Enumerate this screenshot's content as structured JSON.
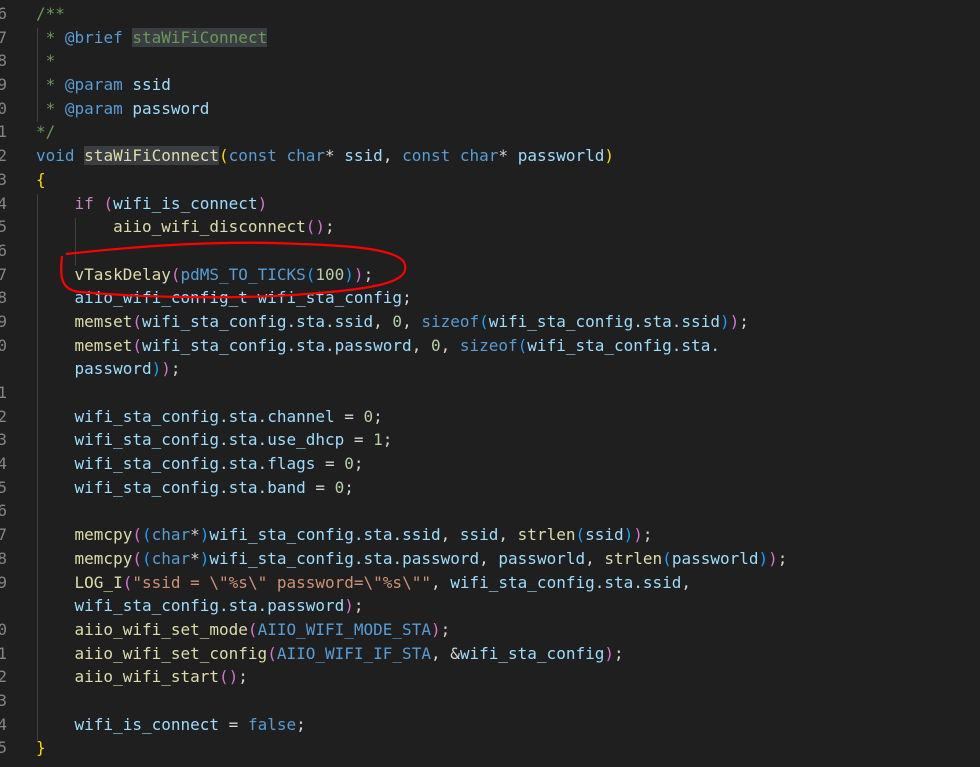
{
  "editor": {
    "colors": {
      "background": "#1f1f1f",
      "comment": "#6a9955",
      "keyword": "#569cd6",
      "variable": "#9cdcfe",
      "function": "#dcdcaa",
      "annotation": "#ff0000"
    },
    "lines": [
      {
        "n": "6",
        "t": [
          [
            "/**",
            "cm"
          ]
        ]
      },
      {
        "n": "7",
        "t": [
          [
            " * ",
            "cm"
          ],
          [
            "@brief",
            "tag"
          ],
          [
            " ",
            "cm"
          ],
          [
            "staWiFiConnect",
            "cm hl"
          ]
        ]
      },
      {
        "n": "8",
        "t": [
          [
            " *",
            "cm"
          ]
        ]
      },
      {
        "n": "9",
        "t": [
          [
            " * ",
            "cm"
          ],
          [
            "@param",
            "tag"
          ],
          [
            " ",
            "cm"
          ],
          [
            "ssid",
            "var"
          ]
        ]
      },
      {
        "n": "0",
        "t": [
          [
            " * ",
            "cm"
          ],
          [
            "@param",
            "tag"
          ],
          [
            " ",
            "cm"
          ],
          [
            "password",
            "var"
          ]
        ]
      },
      {
        "n": "1",
        "t": [
          [
            "*/",
            "cm"
          ]
        ]
      },
      {
        "n": "2",
        "t": [
          [
            "void",
            "kw"
          ],
          [
            " ",
            "op"
          ],
          [
            "staWiFiConnect",
            "fn hl"
          ],
          [
            "(",
            "b1"
          ],
          [
            "const",
            "kw"
          ],
          [
            " ",
            "op"
          ],
          [
            "char",
            "kw"
          ],
          [
            "* ",
            "op"
          ],
          [
            "ssid",
            "var"
          ],
          [
            ", ",
            "op"
          ],
          [
            "const",
            "kw"
          ],
          [
            " ",
            "op"
          ],
          [
            "char",
            "kw"
          ],
          [
            "* ",
            "op"
          ],
          [
            "passworld",
            "var"
          ],
          [
            ")",
            "b1"
          ]
        ]
      },
      {
        "n": "3",
        "t": [
          [
            "{",
            "b1"
          ]
        ]
      },
      {
        "n": "4",
        "t": [
          [
            "    ",
            "op"
          ],
          [
            "if",
            "ctl"
          ],
          [
            " ",
            "op"
          ],
          [
            "(",
            "b2"
          ],
          [
            "wifi_is_connect",
            "var"
          ],
          [
            ")",
            "b2"
          ]
        ]
      },
      {
        "n": "5",
        "t": [
          [
            "        ",
            "op"
          ],
          [
            "aiio_wifi_disconnect",
            "fn"
          ],
          [
            "()",
            "b2"
          ],
          [
            ";",
            "op"
          ]
        ]
      },
      {
        "n": "6",
        "t": []
      },
      {
        "n": "7",
        "t": [
          [
            "    ",
            "op"
          ],
          [
            "vTaskDelay",
            "fn"
          ],
          [
            "(",
            "b2"
          ],
          [
            "pdMS_TO_TICKS",
            "mac"
          ],
          [
            "(",
            "b3"
          ],
          [
            "100",
            "num"
          ],
          [
            ")",
            "b3"
          ],
          [
            ")",
            "b2"
          ],
          [
            ";",
            "op"
          ]
        ]
      },
      {
        "n": "8",
        "t": [
          [
            "    ",
            "op"
          ],
          [
            "aiio_wifi_config_t",
            "var"
          ],
          [
            " ",
            "op"
          ],
          [
            "wifi_sta_config",
            "var"
          ],
          [
            ";",
            "op"
          ]
        ]
      },
      {
        "n": "9",
        "t": [
          [
            "    ",
            "op"
          ],
          [
            "memset",
            "fn"
          ],
          [
            "(",
            "b2"
          ],
          [
            "wifi_sta_config.sta.ssid",
            "var"
          ],
          [
            ", ",
            "op"
          ],
          [
            "0",
            "num"
          ],
          [
            ", ",
            "op"
          ],
          [
            "sizeof",
            "kw"
          ],
          [
            "(",
            "b3"
          ],
          [
            "wifi_sta_config.sta.ssid",
            "var"
          ],
          [
            ")",
            "b3"
          ],
          [
            ")",
            "b2"
          ],
          [
            ";",
            "op"
          ]
        ]
      },
      {
        "n": "0",
        "t": [
          [
            "    ",
            "op"
          ],
          [
            "memset",
            "fn"
          ],
          [
            "(",
            "b2"
          ],
          [
            "wifi_sta_config.sta.password",
            "var"
          ],
          [
            ", ",
            "op"
          ],
          [
            "0",
            "num"
          ],
          [
            ", ",
            "op"
          ],
          [
            "sizeof",
            "kw"
          ],
          [
            "(",
            "b3"
          ],
          [
            "wifi_sta_config.sta.",
            "var"
          ]
        ]
      },
      {
        "n": "",
        "t": [
          [
            "    ",
            "op"
          ],
          [
            "password",
            "var"
          ],
          [
            ")",
            "b3"
          ],
          [
            ")",
            "b2"
          ],
          [
            ";",
            "op"
          ]
        ]
      },
      {
        "n": "1",
        "t": []
      },
      {
        "n": "2",
        "t": [
          [
            "    ",
            "op"
          ],
          [
            "wifi_sta_config.sta.channel",
            "var"
          ],
          [
            " = ",
            "op"
          ],
          [
            "0",
            "num"
          ],
          [
            ";",
            "op"
          ]
        ]
      },
      {
        "n": "3",
        "t": [
          [
            "    ",
            "op"
          ],
          [
            "wifi_sta_config.sta.use_dhcp",
            "var"
          ],
          [
            " = ",
            "op"
          ],
          [
            "1",
            "num"
          ],
          [
            ";",
            "op"
          ]
        ]
      },
      {
        "n": "4",
        "t": [
          [
            "    ",
            "op"
          ],
          [
            "wifi_sta_config.sta.flags",
            "var"
          ],
          [
            " = ",
            "op"
          ],
          [
            "0",
            "num"
          ],
          [
            ";",
            "op"
          ]
        ]
      },
      {
        "n": "5",
        "t": [
          [
            "    ",
            "op"
          ],
          [
            "wifi_sta_config.sta.band",
            "var"
          ],
          [
            " = ",
            "op"
          ],
          [
            "0",
            "num"
          ],
          [
            ";",
            "op"
          ]
        ]
      },
      {
        "n": "6",
        "t": []
      },
      {
        "n": "7",
        "t": [
          [
            "    ",
            "op"
          ],
          [
            "memcpy",
            "fn"
          ],
          [
            "(",
            "b2"
          ],
          [
            "(",
            "b3"
          ],
          [
            "char",
            "kw"
          ],
          [
            "*",
            "op"
          ],
          [
            ")",
            "b3"
          ],
          [
            "wifi_sta_config.sta.ssid",
            "var"
          ],
          [
            ", ",
            "op"
          ],
          [
            "ssid",
            "var"
          ],
          [
            ", ",
            "op"
          ],
          [
            "strlen",
            "fn"
          ],
          [
            "(",
            "b3"
          ],
          [
            "ssid",
            "var"
          ],
          [
            ")",
            "b3"
          ],
          [
            ")",
            "b2"
          ],
          [
            ";",
            "op"
          ]
        ]
      },
      {
        "n": "8",
        "t": [
          [
            "    ",
            "op"
          ],
          [
            "memcpy",
            "fn"
          ],
          [
            "(",
            "b2"
          ],
          [
            "(",
            "b3"
          ],
          [
            "char",
            "kw"
          ],
          [
            "*",
            "op"
          ],
          [
            ")",
            "b3"
          ],
          [
            "wifi_sta_config.sta.password",
            "var"
          ],
          [
            ", ",
            "op"
          ],
          [
            "passworld",
            "var"
          ],
          [
            ", ",
            "op"
          ],
          [
            "strlen",
            "fn"
          ],
          [
            "(",
            "b3"
          ],
          [
            "passworld",
            "var"
          ],
          [
            ")",
            "b3"
          ],
          [
            ")",
            "b2"
          ],
          [
            ";",
            "op"
          ]
        ]
      },
      {
        "n": "9",
        "t": [
          [
            "    ",
            "op"
          ],
          [
            "LOG_I",
            "fn"
          ],
          [
            "(",
            "b2"
          ],
          [
            "\"ssid = \\\"%s\\\" password=\\\"%s\\\"\"",
            "str"
          ],
          [
            ", ",
            "op"
          ],
          [
            "wifi_sta_config.sta.ssid",
            "var"
          ],
          [
            ",",
            "op"
          ]
        ]
      },
      {
        "n": "",
        "t": [
          [
            "    ",
            "op"
          ],
          [
            "wifi_sta_config.sta.password",
            "var"
          ],
          [
            ")",
            "b2"
          ],
          [
            ";",
            "op"
          ]
        ]
      },
      {
        "n": "0",
        "t": [
          [
            "    ",
            "op"
          ],
          [
            "aiio_wifi_set_mode",
            "fn"
          ],
          [
            "(",
            "b2"
          ],
          [
            "AIIO_WIFI_MODE_STA",
            "mac"
          ],
          [
            ")",
            "b2"
          ],
          [
            ";",
            "op"
          ]
        ]
      },
      {
        "n": "1",
        "t": [
          [
            "    ",
            "op"
          ],
          [
            "aiio_wifi_set_config",
            "fn"
          ],
          [
            "(",
            "b2"
          ],
          [
            "AIIO_WIFI_IF_STA",
            "mac"
          ],
          [
            ", &",
            "op"
          ],
          [
            "wifi_sta_config",
            "var"
          ],
          [
            ")",
            "b2"
          ],
          [
            ";",
            "op"
          ]
        ]
      },
      {
        "n": "2",
        "t": [
          [
            "    ",
            "op"
          ],
          [
            "aiio_wifi_start",
            "fn"
          ],
          [
            "()",
            "b2"
          ],
          [
            ";",
            "op"
          ]
        ]
      },
      {
        "n": "3",
        "t": []
      },
      {
        "n": "4",
        "t": [
          [
            "    ",
            "op"
          ],
          [
            "wifi_is_connect",
            "var"
          ],
          [
            " = ",
            "op"
          ],
          [
            "false",
            "kw"
          ],
          [
            ";",
            "op"
          ]
        ]
      },
      {
        "n": "5",
        "t": [
          [
            "}",
            "b1"
          ]
        ]
      }
    ]
  }
}
